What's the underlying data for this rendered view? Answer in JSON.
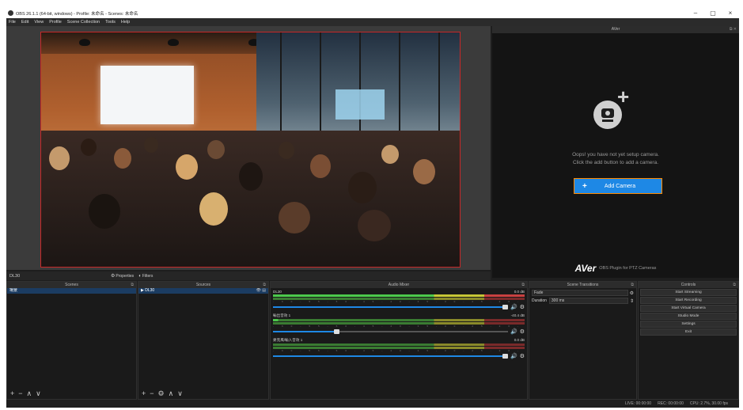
{
  "window": {
    "title": "OBS 26.1.1 (64-bit, windows) - Profile: 未命名 - Scenes: 未命名",
    "min": "–",
    "max": "▢",
    "close": "×"
  },
  "menu": [
    "File",
    "Edit",
    "View",
    "Profile",
    "Scene Collection",
    "Tools",
    "Help"
  ],
  "aver_dock": {
    "title": "AVer",
    "message_line1": "Oops! you have not yet setup camera.",
    "message_line2": "Click the add button to add a camera.",
    "add_button": "Add Camera",
    "add_plus": "+",
    "logo": "AVer",
    "footer": "OBS Plugin for PTZ Cameras"
  },
  "source_toolbar": {
    "source_name": "DL30",
    "properties": "Properties",
    "filters": "Filters"
  },
  "scenes": {
    "title": "Scenes",
    "items": [
      "場景"
    ]
  },
  "sources": {
    "title": "Sources",
    "items": [
      "DL30"
    ]
  },
  "mixer": {
    "title": "Audio Mixer",
    "tracks": [
      {
        "name": "DL30",
        "db": "0.0 dB",
        "volume": 1.0
      },
      {
        "name": "輸出音效 1",
        "db": "-40.4 dB",
        "volume": 0.28
      },
      {
        "name": "麥克風/輸入音效 1",
        "db": "0.0 dB",
        "volume": 1.0
      }
    ]
  },
  "transitions": {
    "title": "Scene Transitions",
    "type": "Fade",
    "duration_label": "Duration",
    "duration_value": "300 ms"
  },
  "controls": {
    "title": "Controls",
    "buttons": [
      "Start Streaming",
      "Start Recording",
      "Start Virtual Camera",
      "Studio Mode",
      "Settings",
      "Exit"
    ]
  },
  "status": {
    "live": "LIVE: 00:00:00",
    "rec": "REC: 00:00:00",
    "cpu": "CPU: 2.7%, 30.00 fps"
  },
  "colors": {
    "accent_blue": "#1e88e5",
    "highlight_orange": "#ff8a00",
    "preview_border": "#c62828"
  }
}
